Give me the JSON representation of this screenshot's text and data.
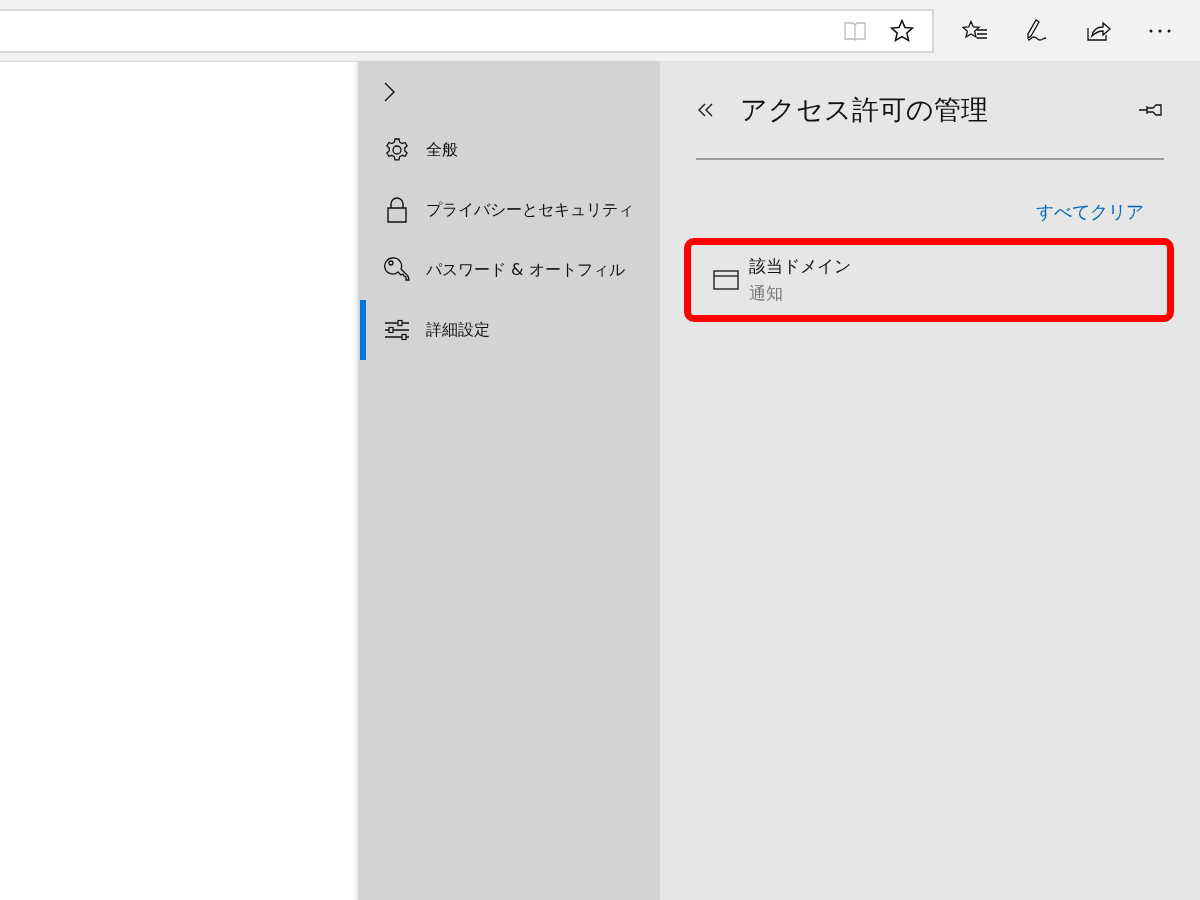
{
  "sidebar": {
    "items": [
      {
        "label": "全般",
        "kind": "gear",
        "selected": false
      },
      {
        "label": "プライバシーとセキュリティ",
        "kind": "lock",
        "selected": false
      },
      {
        "label": "パスワード & オートフィル",
        "kind": "key",
        "selected": false
      },
      {
        "label": "詳細設定",
        "kind": "sliders",
        "selected": true
      }
    ]
  },
  "panel": {
    "title": "アクセス許可の管理",
    "clear_all": "すべてクリア",
    "sites": [
      {
        "name": "該当ドメイン",
        "permission": "通知",
        "highlighted": true
      }
    ]
  }
}
